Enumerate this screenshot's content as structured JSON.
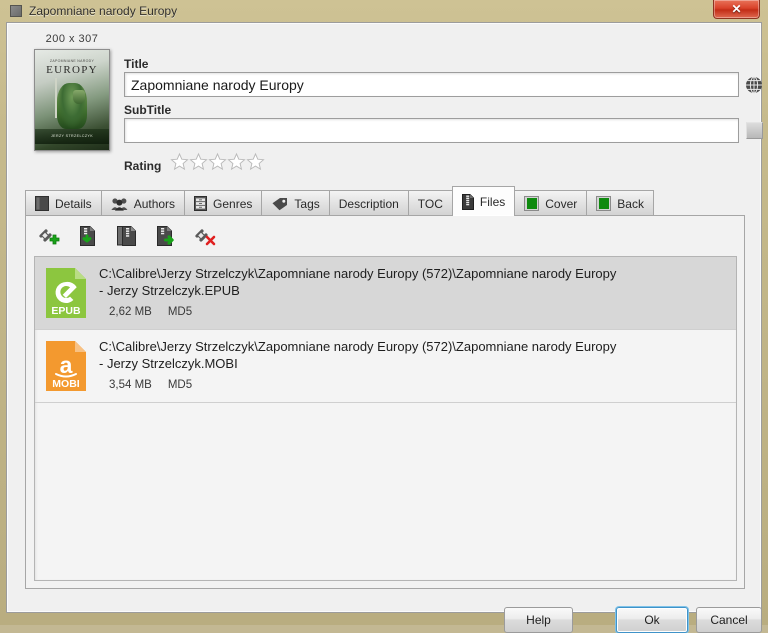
{
  "window": {
    "title": "Zapomniane narody Europy",
    "title_icon": "book-icon",
    "close_label": "✕"
  },
  "header": {
    "cover": {
      "dimensions": "200 x 307",
      "icon": "book-cover-thumbnail",
      "cover_top_text": "ZAPOMNIANE NARODY",
      "cover_title_text": "EUROPY",
      "cover_author_text": "JERZY STRZELCZYK"
    },
    "title_field": {
      "label": "Title",
      "value": "Zapomniane narody Europy",
      "placeholder": ""
    },
    "subtitle_field": {
      "label": "SubTitle",
      "value": "",
      "placeholder": ""
    },
    "globe_icon": "globe-icon",
    "subtitle_button_icon": "square-button-icon",
    "rating": {
      "label": "Rating",
      "value": 0,
      "max": 5
    }
  },
  "tabs": [
    {
      "label": "Details",
      "icon": "book-icon",
      "active": false
    },
    {
      "label": "Authors",
      "icon": "people-icon",
      "active": false
    },
    {
      "label": "Genres",
      "icon": "file-cabinet-icon",
      "active": false
    },
    {
      "label": "Tags",
      "icon": "tag-icon",
      "active": false
    },
    {
      "label": "Description",
      "icon": "none",
      "active": false
    },
    {
      "label": "TOC",
      "icon": "none",
      "active": false
    },
    {
      "label": "Files",
      "icon": "zip-file-icon",
      "active": true
    },
    {
      "label": "Cover",
      "icon": "green-book-icon",
      "active": false
    },
    {
      "label": "Back",
      "icon": "green-book-icon",
      "active": false
    }
  ],
  "files_tab": {
    "toolbar": [
      {
        "name": "add-file-button",
        "icon": "link-plus-icon",
        "tooltip": "Add file"
      },
      {
        "name": "import-file-button",
        "icon": "file-download-icon",
        "tooltip": "Import file"
      },
      {
        "name": "copy-file-button",
        "icon": "file-copy-icon",
        "tooltip": "Copy file"
      },
      {
        "name": "export-file-button",
        "icon": "file-export-icon",
        "tooltip": "Export file"
      },
      {
        "name": "remove-file-button",
        "icon": "link-remove-icon",
        "tooltip": "Remove file"
      }
    ],
    "files": [
      {
        "path": "C:\\Calibre\\Jerzy Strzelczyk\\Zapomniane narody Europy (572)\\Zapomniane narody Europy\n- Jerzy Strzelczyk.EPUB",
        "format": "EPUB",
        "icon": "epub-file-icon",
        "color": "#8cc63f",
        "size": "2,62 MB",
        "hash_label": "MD5",
        "selected": true
      },
      {
        "path": "C:\\Calibre\\Jerzy Strzelczyk\\Zapomniane narody Europy (572)\\Zapomniane narody Europy\n- Jerzy Strzelczyk.MOBI",
        "format": "MOBI",
        "icon": "mobi-file-icon",
        "color": "#f3992f",
        "size": "3,54 MB",
        "hash_label": "MD5",
        "selected": false
      }
    ]
  },
  "footer": {
    "help_label": "Help",
    "ok_label": "Ok",
    "cancel_label": "Cancel"
  },
  "colors": {
    "window_frame": "#c6ba8c",
    "epub_green": "#8cc63f",
    "mobi_orange": "#f3992f",
    "focus_blue": "#3f93c9",
    "close_red": "#d9432a"
  }
}
